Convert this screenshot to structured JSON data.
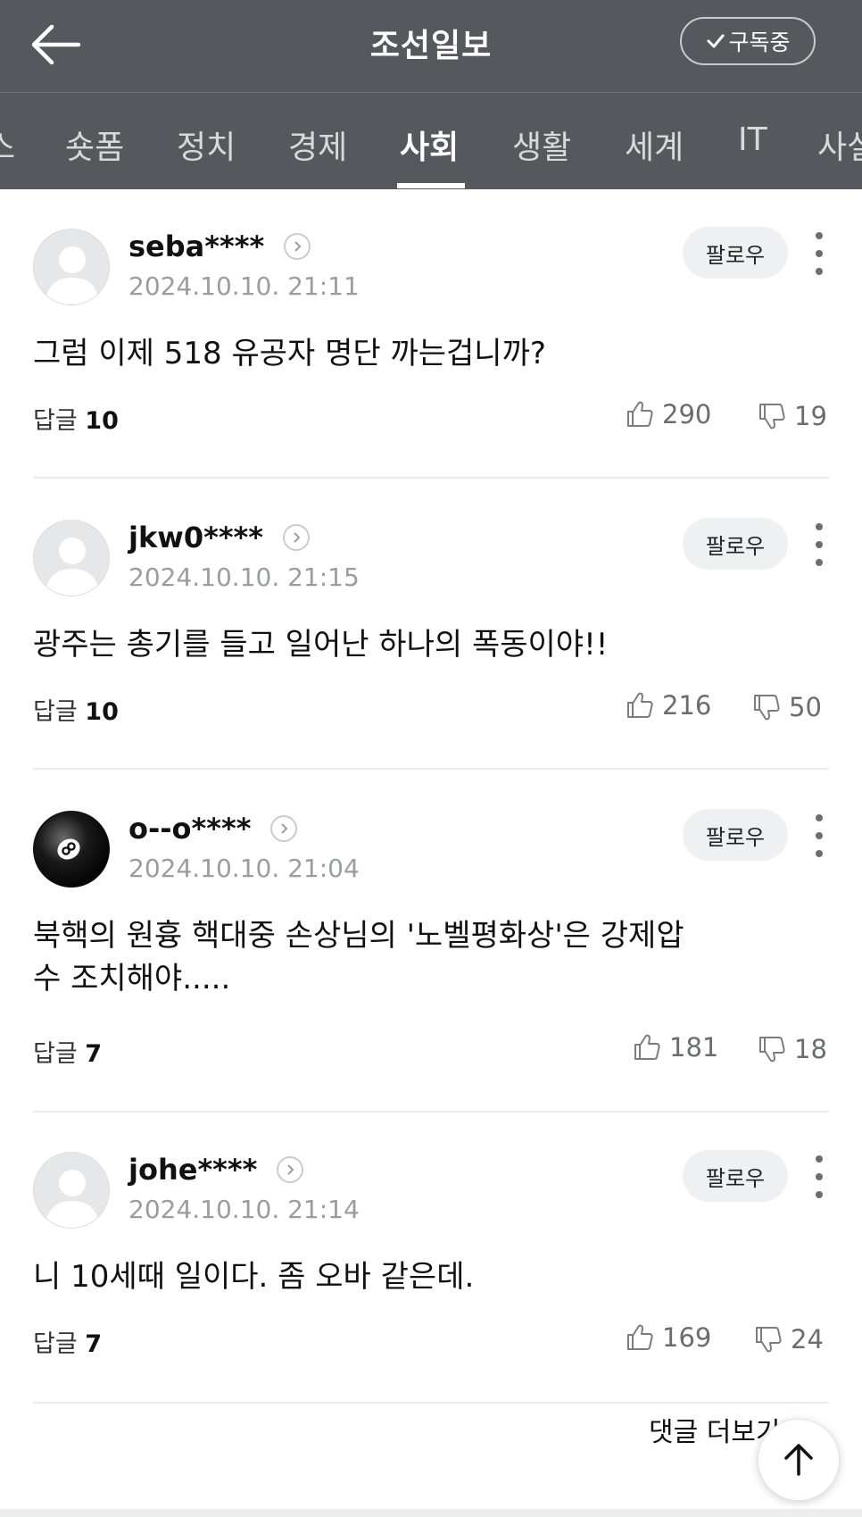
{
  "header": {
    "title": "조선일보",
    "subscribe_label": "구독중",
    "tabs": [
      {
        "label": "스"
      },
      {
        "label": "숏폼"
      },
      {
        "label": "정치"
      },
      {
        "label": "경제"
      },
      {
        "label": "사회",
        "active": true
      },
      {
        "label": "생활"
      },
      {
        "label": "세계"
      },
      {
        "label": "IT"
      },
      {
        "label": "사설"
      }
    ]
  },
  "labels": {
    "follow": "팔로우",
    "reply": "답글",
    "more_comments": "댓글 더보기"
  },
  "comments": [
    {
      "username": "seba****",
      "timestamp": "2024.10.10. 21:11",
      "text": "그럼 이제 518 유공자 명단 까는겁니까?",
      "replies": "10",
      "likes": "290",
      "dislikes": "19",
      "avatar": "default-avatar"
    },
    {
      "username": "jkw0****",
      "timestamp": "2024.10.10. 21:15",
      "text": "광주는 총기를 들고 일어난 하나의 폭동이야!!",
      "replies": "10",
      "likes": "216",
      "dislikes": "50",
      "avatar": "default-avatar"
    },
    {
      "username": "o--o****",
      "timestamp": "2024.10.10. 21:04",
      "text_line1": "북핵의 원흉 핵대중 손상님의 '노벨평화상'은 강제압",
      "text_line2": "수 조치해야.....",
      "replies": "7",
      "likes": "181",
      "dislikes": "18",
      "avatar": "eight-ball-avatar"
    },
    {
      "username": "johe****",
      "timestamp": "2024.10.10. 21:14",
      "text": "니 10세때 일이다. 좀 오바 같은데.",
      "replies": "7",
      "likes": "169",
      "dislikes": "24",
      "avatar": "default-avatar"
    }
  ],
  "colors": {
    "header_bg": "#55585c",
    "follow_bg": "#eff0f1",
    "timestamp": "#9a9ca0"
  }
}
